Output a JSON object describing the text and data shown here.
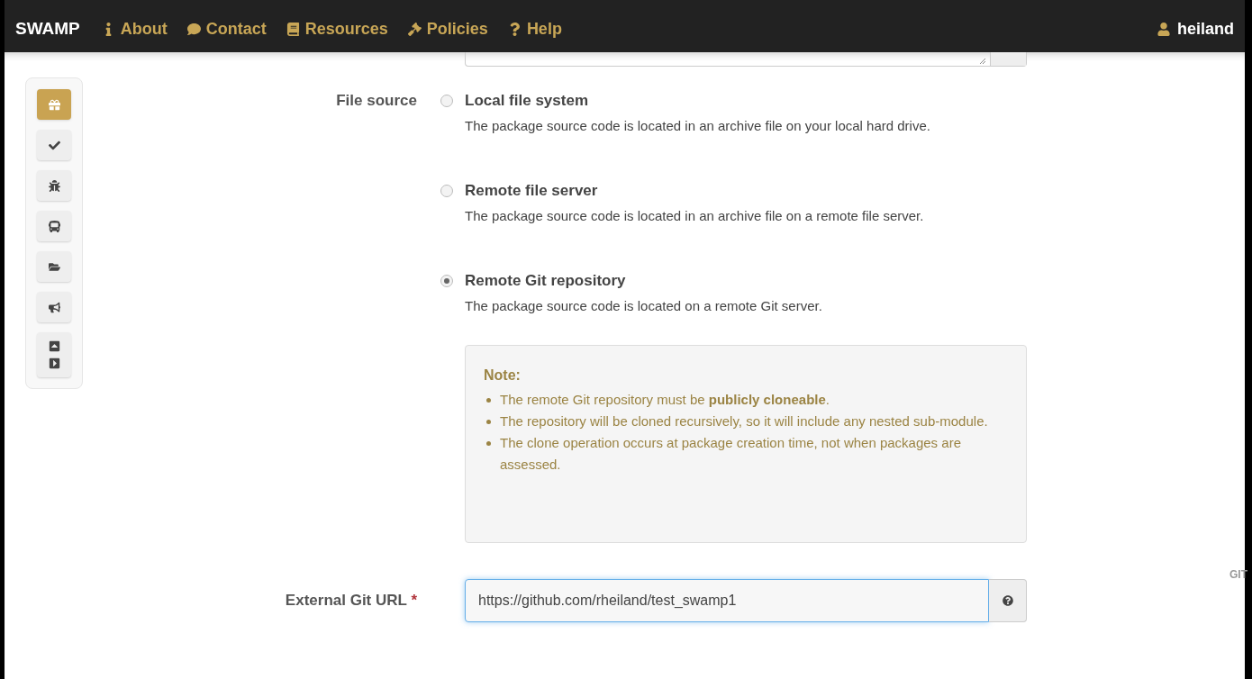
{
  "nav": {
    "brand": "SWAMP",
    "links": [
      {
        "label": "About"
      },
      {
        "label": "Contact"
      },
      {
        "label": "Resources"
      },
      {
        "label": "Policies"
      },
      {
        "label": "Help"
      }
    ],
    "user": "heiland"
  },
  "sidebar": {
    "items": [
      {
        "selected": true
      },
      {
        "selected": false
      },
      {
        "selected": false
      },
      {
        "selected": false
      },
      {
        "selected": false
      },
      {
        "selected": false
      },
      {
        "selected": false
      }
    ]
  },
  "form": {
    "file_source": {
      "label": "File source",
      "options": [
        {
          "title": "Local file system",
          "description": "The package source code is located in an archive file on your local hard drive.",
          "selected": false
        },
        {
          "title": "Remote file server",
          "description": "The package source code is located in an archive file on a remote file server.",
          "selected": false
        },
        {
          "title": "Remote Git repository",
          "description": "The package source code is located on a remote Git server.",
          "selected": true
        }
      ]
    },
    "note": {
      "title": "Note:",
      "items": [
        "The remote Git repository must be **publicly cloneable**.",
        "The repository will be cloned recursively, so it will include any nested sub-module.",
        "The clone operation occurs at package creation time, not when packages are assessed."
      ]
    },
    "git_url": {
      "label": "External Git URL",
      "required_mark": "*",
      "value": "https://github.com/rheiland/test_swamp1"
    }
  },
  "edge_text": "GIT"
}
